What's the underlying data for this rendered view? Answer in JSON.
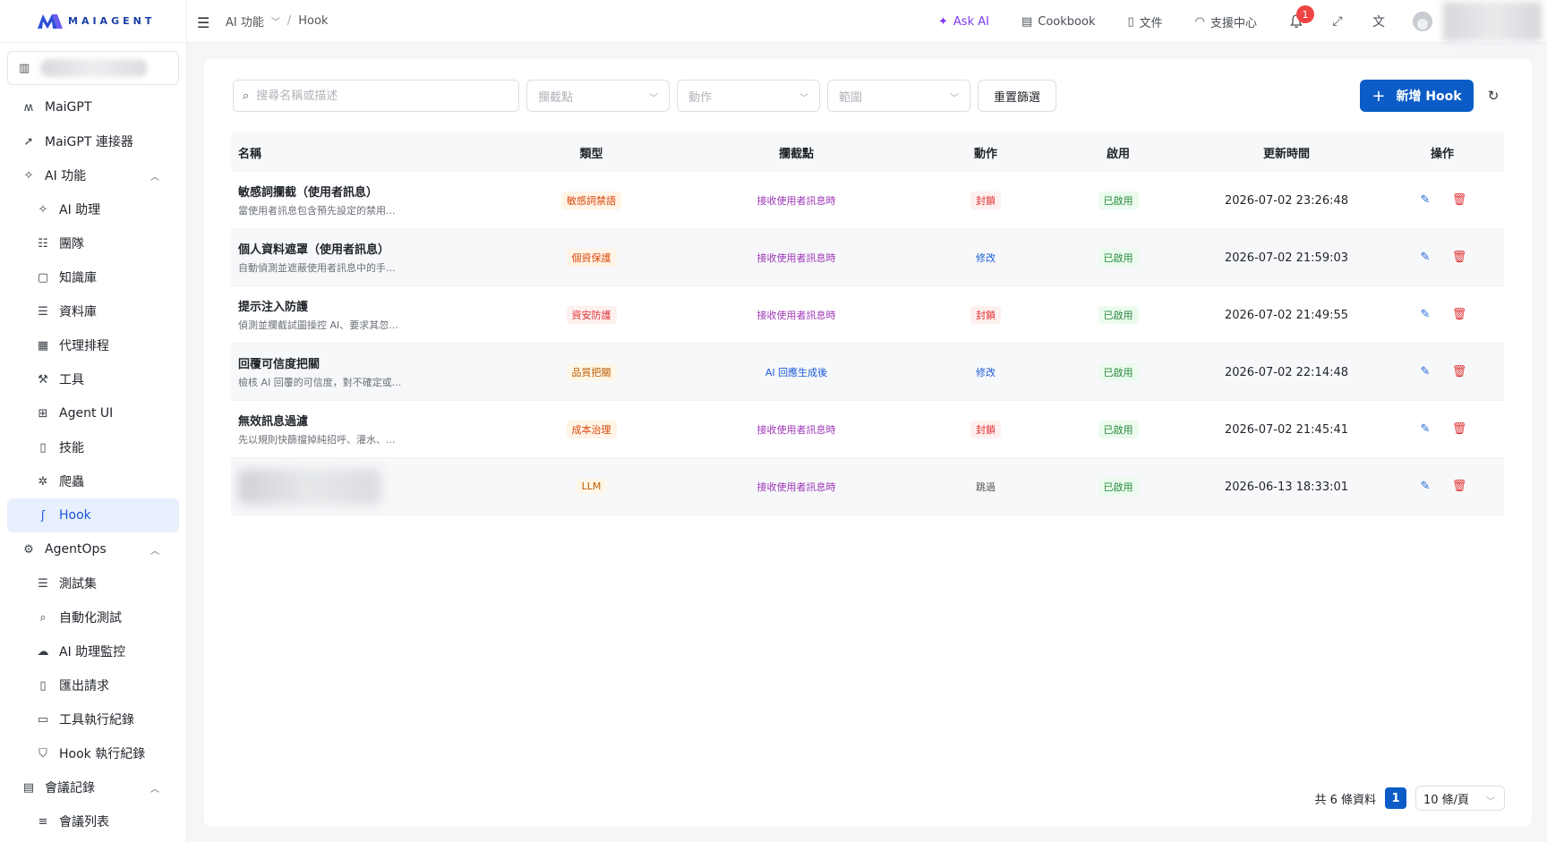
{
  "brand": {
    "name": "MAIAGENT"
  },
  "sidebar": {
    "items": [
      {
        "label": "MaiGPT",
        "level": 1,
        "icon": "maigpt-logo-icon"
      },
      {
        "label": "MaiGPT 連接器",
        "level": 1,
        "icon": "rocket-icon"
      },
      {
        "label": "AI 功能",
        "level": 1,
        "icon": "sparkle-icon",
        "expanded": true
      },
      {
        "label": "AI 助理",
        "level": 2,
        "icon": "sparkle-icon"
      },
      {
        "label": "團隊",
        "level": 2,
        "icon": "team-icon"
      },
      {
        "label": "知識庫",
        "level": 2,
        "icon": "book-icon"
      },
      {
        "label": "資料庫",
        "level": 2,
        "icon": "database-icon"
      },
      {
        "label": "代理排程",
        "level": 2,
        "icon": "calendar-icon"
      },
      {
        "label": "工具",
        "level": 2,
        "icon": "wrench-icon"
      },
      {
        "label": "Agent UI",
        "level": 2,
        "icon": "grid-icon"
      },
      {
        "label": "技能",
        "level": 2,
        "icon": "file-code-icon"
      },
      {
        "label": "爬蟲",
        "level": 2,
        "icon": "bug-icon"
      },
      {
        "label": "Hook",
        "level": 2,
        "icon": "hook-icon",
        "active": true
      },
      {
        "label": "AgentOps",
        "level": 1,
        "icon": "agentops-icon",
        "expanded": true
      },
      {
        "label": "測試集",
        "level": 2,
        "icon": "database-icon"
      },
      {
        "label": "自動化測試",
        "level": 2,
        "icon": "search-icon"
      },
      {
        "label": "AI 助理監控",
        "level": 2,
        "icon": "cloud-icon"
      },
      {
        "label": "匯出請求",
        "level": 2,
        "icon": "file-export-icon"
      },
      {
        "label": "工具執行紀錄",
        "level": 2,
        "icon": "toolbox-icon"
      },
      {
        "label": "Hook 執行紀錄",
        "level": 2,
        "icon": "shield-icon"
      },
      {
        "label": "會議記錄",
        "level": 1,
        "icon": "meeting-icon",
        "expanded": true
      },
      {
        "label": "會議列表",
        "level": 2,
        "icon": "list-icon"
      }
    ]
  },
  "header": {
    "breadcrumb": {
      "parent": "AI 功能",
      "current": "Hook"
    },
    "ask_ai": "Ask AI",
    "cookbook": "Cookbook",
    "docs": "文件",
    "support": "支援中心",
    "notification_count": "1"
  },
  "toolbar": {
    "search_placeholder": "搜尋名稱或描述",
    "filter_point": "攔截點",
    "filter_action": "動作",
    "filter_scope": "範圍",
    "reset_label": "重置篩選",
    "add_label": "新增 Hook"
  },
  "table": {
    "headers": {
      "name": "名稱",
      "type": "類型",
      "point": "攔截點",
      "action": "動作",
      "enabled": "啟用",
      "updated": "更新時間",
      "ops": "操作"
    },
    "rows": [
      {
        "title": "敏感詞攔截（使用者訊息）",
        "desc": "當使用者訊息包含預先設定的禁用...",
        "type": "敏感詞禁語",
        "type_style": "t-orange",
        "point": "接收使用者訊息時",
        "point_style": "t-purple",
        "action": "封鎖",
        "action_style": "t-red",
        "enabled": "已啟用",
        "updated": "2026-07-02 23:26:48"
      },
      {
        "title": "個人資料遮罩（使用者訊息）",
        "desc": "自動偵測並遮蔽使用者訊息中的手...",
        "type": "個資保護",
        "type_style": "t-orange",
        "point": "接收使用者訊息時",
        "point_style": "t-purple",
        "action": "修改",
        "action_style": "t-blue",
        "enabled": "已啟用",
        "updated": "2026-07-02 21:59:03"
      },
      {
        "title": "提示注入防護",
        "desc": "偵測並攔截試圖操控 AI、要求其忽...",
        "type": "資安防護",
        "type_style": "t-red",
        "point": "接收使用者訊息時",
        "point_style": "t-purple",
        "action": "封鎖",
        "action_style": "t-red",
        "enabled": "已啟用",
        "updated": "2026-07-02 21:49:55"
      },
      {
        "title": "回覆可信度把關",
        "desc": "檢核 AI 回覆的可信度，對不確定或...",
        "type": "品質把關",
        "type_style": "t-gold",
        "point": "AI 回應生成後",
        "point_style": "t-blue",
        "action": "修改",
        "action_style": "t-blue",
        "enabled": "已啟用",
        "updated": "2026-07-02 22:14:48"
      },
      {
        "title": "無效訊息過濾",
        "desc": "先以規則快篩擋掉純招呼、灌水、...",
        "type": "成本治理",
        "type_style": "t-orange",
        "point": "接收使用者訊息時",
        "point_style": "t-purple",
        "action": "封鎖",
        "action_style": "t-red",
        "enabled": "已啟用",
        "updated": "2026-07-02 21:45:41"
      },
      {
        "title": "",
        "desc": "",
        "blurred": true,
        "type": "LLM",
        "type_style": "t-gold",
        "point": "接收使用者訊息時",
        "point_style": "t-purple",
        "action": "跳過",
        "action_style": "t-gray",
        "enabled": "已啟用",
        "updated": "2026-06-13 18:33:01"
      }
    ]
  },
  "pagination": {
    "total": "共 6 條資料",
    "current": "1",
    "page_size": "10 條/頁"
  }
}
